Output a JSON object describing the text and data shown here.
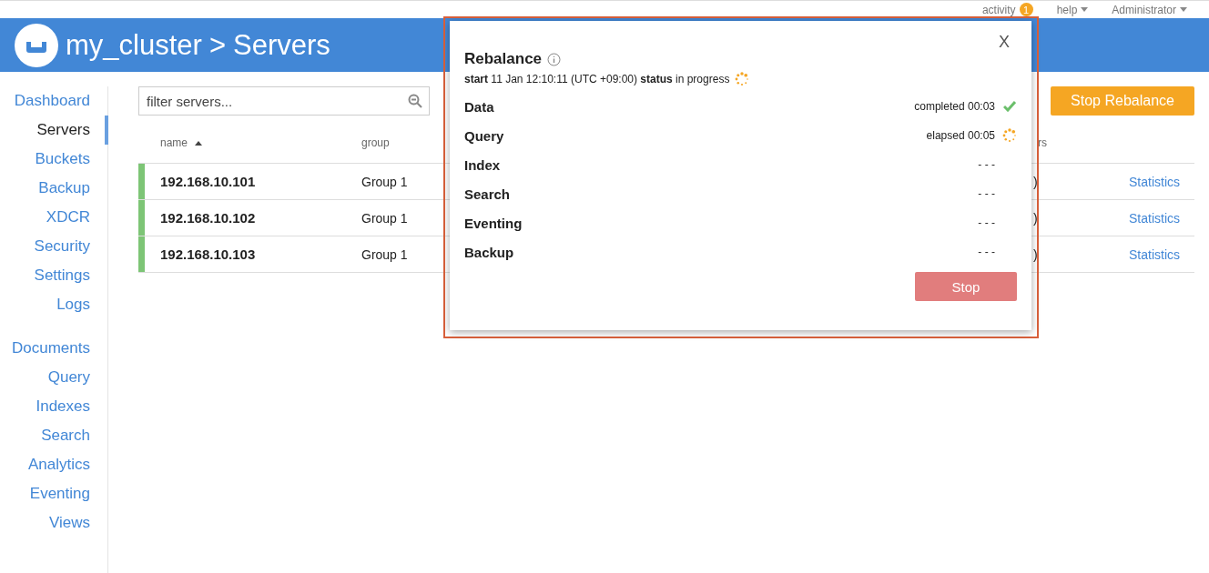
{
  "topbar": {
    "activity": {
      "label": "activity",
      "badge": "1"
    },
    "help": "help",
    "user": "Administrator"
  },
  "header": {
    "cluster": "my_cluster",
    "separator": ">",
    "page": "Servers"
  },
  "sidebar": {
    "groups": [
      [
        {
          "label": "Dashboard",
          "selected": false
        },
        {
          "label": "Servers",
          "selected": true
        },
        {
          "label": "Buckets",
          "selected": false
        },
        {
          "label": "Backup",
          "selected": false
        },
        {
          "label": "XDCR",
          "selected": false
        },
        {
          "label": "Security",
          "selected": false
        },
        {
          "label": "Settings",
          "selected": false
        },
        {
          "label": "Logs",
          "selected": false
        }
      ],
      [
        {
          "label": "Documents",
          "selected": false
        },
        {
          "label": "Query",
          "selected": false
        },
        {
          "label": "Indexes",
          "selected": false
        },
        {
          "label": "Search",
          "selected": false
        },
        {
          "label": "Analytics",
          "selected": false
        },
        {
          "label": "Eventing",
          "selected": false
        },
        {
          "label": "Views",
          "selected": false
        }
      ]
    ]
  },
  "filter": {
    "placeholder": "filter servers..."
  },
  "stop_rebalance_button": "Stop Rebalance",
  "table": {
    "columns": [
      {
        "label": "name",
        "sorted": true
      },
      {
        "label": "group",
        "sorted": false
      },
      {
        "label": "rs",
        "sorted": false
      }
    ],
    "rows": [
      {
        "name": "192.168.10.101",
        "group": "Group 1",
        "column_3": ")",
        "link": "Statistics",
        "color": "#7dc576"
      },
      {
        "name": "192.168.10.102",
        "group": "Group 1",
        "column_3": ")",
        "link": "Statistics",
        "color": "#7dc576"
      },
      {
        "name": "192.168.10.103",
        "group": "Group 1",
        "column_3": ")",
        "link": "Statistics",
        "color": "#7dc576"
      }
    ]
  },
  "modal": {
    "close": "X",
    "title": "Rebalance",
    "summary": "**start** 11 Jan 12:10:11 (UTC +09:00) **status** in progress",
    "in_progress": true,
    "services": [
      {
        "name": "Data",
        "status": "completed 00:03",
        "kind": "done"
      },
      {
        "name": "Query",
        "status": "elapsed 00:05",
        "kind": "running"
      },
      {
        "name": "Index",
        "status": "- - -",
        "kind": "pending"
      },
      {
        "name": "Search",
        "status": "- - -",
        "kind": "pending"
      },
      {
        "name": "Eventing",
        "status": "- - -",
        "kind": "pending"
      },
      {
        "name": "Backup",
        "status": "- - -",
        "kind": "pending"
      }
    ],
    "stop_button": "Stop"
  }
}
